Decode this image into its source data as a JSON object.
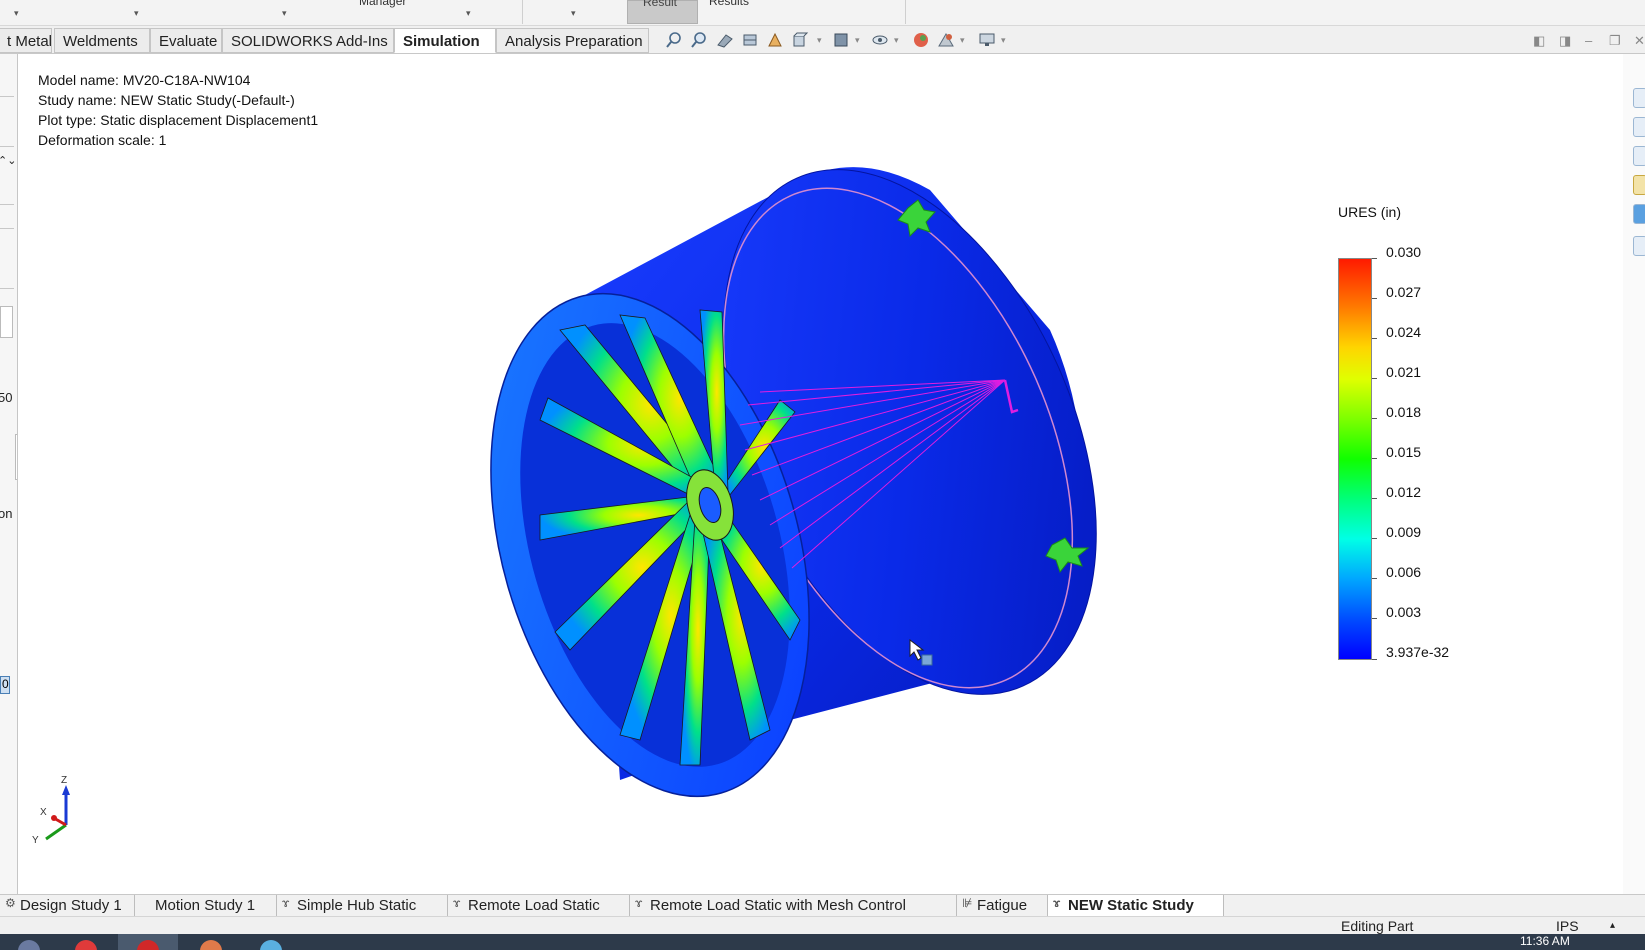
{
  "ribbon": {
    "manager_caption": "Manager",
    "result_button": "Result",
    "results_caption": "Results"
  },
  "tabs": [
    {
      "label": "t Metal"
    },
    {
      "label": "Weldments"
    },
    {
      "label": "Evaluate"
    },
    {
      "label": "SOLIDWORKS Add-Ins"
    },
    {
      "label": "Simulation"
    },
    {
      "label": "Analysis Preparation"
    }
  ],
  "toolbar_icons": [
    "zoom-to-fit-icon",
    "zoom-to-area-icon",
    "previous-view-icon",
    "section-view-icon",
    "dynamic-annotation-icon",
    "view-orientation-icon",
    "display-style-icon",
    "hide-show-items-icon",
    "edit-appearance-icon",
    "apply-scene-icon",
    "view-settings-icon"
  ],
  "left_panel_fragments": [
    "50",
    "on",
    "0"
  ],
  "plot_info": {
    "model": "Model name: MV20-C18A-NW104",
    "study": "Study name: NEW Static Study(-Default-)",
    "plot_type": "Plot type: Static displacement Displacement1",
    "deformation": "Deformation scale: 1"
  },
  "legend": {
    "title": "URES (in)",
    "labels": [
      "0.030",
      "0.027",
      "0.024",
      "0.021",
      "0.018",
      "0.015",
      "0.012",
      "0.009",
      "0.006",
      "0.003",
      "3.937e-32"
    ],
    "colors": [
      "#ff1a00",
      "#0000ff"
    ]
  },
  "triad": {
    "z": "Z",
    "x": "X",
    "y": "Y"
  },
  "study_tabs": [
    {
      "label": "Design Study 1"
    },
    {
      "label": "Motion Study 1"
    },
    {
      "label": "Simple Hub Static"
    },
    {
      "label": "Remote Load Static"
    },
    {
      "label": "Remote Load Static with Mesh Control"
    },
    {
      "label": "Fatigue"
    },
    {
      "label": "NEW Static Study"
    }
  ],
  "status": {
    "editing": "Editing Part",
    "units": "IPS"
  },
  "taskbar": {
    "clock": "11:36 AM"
  }
}
